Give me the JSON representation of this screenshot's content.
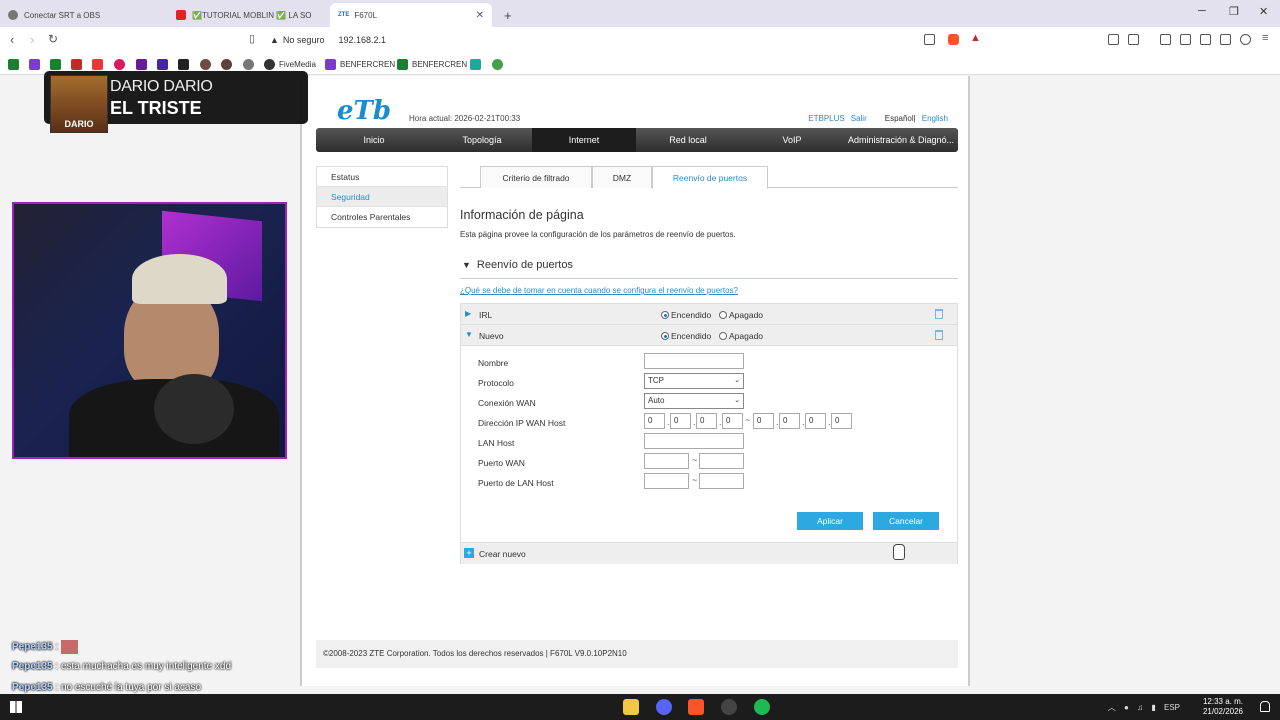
{
  "browser": {
    "tabs": [
      {
        "label": "Conectar SRT a OBS",
        "color": "#666"
      },
      {
        "label": "✅TUTORIAL MOBLIN ✅ LA SOLUCIÓ",
        "color": "#e02424"
      },
      {
        "label": "F670L",
        "prefix": "ZTE",
        "color": "#1a6bc4"
      }
    ],
    "new_tab": "+",
    "security_label": "No seguro",
    "url": "192.168.2.1",
    "bookmarks": [
      {
        "label": "",
        "color": "#1a7f2e"
      },
      {
        "label": "",
        "color": "#7d3cc8"
      },
      {
        "label": "",
        "color": "#1a7f2e"
      },
      {
        "label": "",
        "color": "#c62828"
      },
      {
        "label": "",
        "color": "#e53935"
      },
      {
        "label": "",
        "color": "#d81b60"
      },
      {
        "label": "",
        "color": "#6a1b9a"
      },
      {
        "label": "",
        "color": "#4527a0"
      },
      {
        "label": "",
        "color": "#212121"
      },
      {
        "label": "",
        "color": "#6d4c41"
      },
      {
        "label": "",
        "color": "#5d4037"
      },
      {
        "label": "FiveMedia",
        "color": "#333"
      },
      {
        "label": "BENFERCREN",
        "color": "#7d3cc8"
      },
      {
        "label": "BENFERCREN",
        "color": "#1a7f2e"
      },
      {
        "label": "",
        "color": "#26a69a"
      },
      {
        "label": "",
        "color": "#43a047"
      }
    ]
  },
  "router": {
    "logo": "eTb",
    "time_label": "Hora actual: 2026-02-21T00:33",
    "top_links": [
      "ETBPLUS",
      "Salir"
    ],
    "lang": {
      "current": "Español",
      "separator": "|",
      "other": "English"
    },
    "menu": [
      {
        "label": "Inicio",
        "active": false
      },
      {
        "label": "Topología",
        "active": false
      },
      {
        "label": "Internet",
        "active": true
      },
      {
        "label": "Red local",
        "active": false
      },
      {
        "label": "VoIP",
        "active": false
      },
      {
        "label": "Administración & Diagnó...",
        "active": false
      }
    ],
    "sidenav": [
      {
        "label": "Estatus",
        "active": false
      },
      {
        "label": "Seguridad",
        "active": true
      },
      {
        "label": "Controles Parentales",
        "active": false
      }
    ],
    "subtabs": [
      {
        "label": "Criterio de filtrado",
        "active": false
      },
      {
        "label": "DMZ",
        "active": false
      },
      {
        "label": "Reenvío de puertos",
        "active": true
      }
    ],
    "page_info_title": "Información de página",
    "page_info_desc": "Esta página provee la configuración de los parámetros de reenvío de puertos.",
    "section_title": "Reenvío de puertos",
    "help_link": "¿Qué se debe de tomar en cuenta cuando se configura el reenvío de puertos?",
    "rules": [
      {
        "name": "IRL",
        "on_label": "Encendido",
        "off_label": "Apagado",
        "enabled": true
      },
      {
        "name": "Nuevo",
        "on_label": "Encendido",
        "off_label": "Apagado",
        "enabled": true
      }
    ],
    "form": {
      "nombre_label": "Nombre",
      "nombre_value": "",
      "protocolo_label": "Protocolo",
      "protocolo_value": "TCP",
      "conexion_label": "Conexión WAN",
      "conexion_value": "Auto",
      "ip_wan_label": "Dirección IP WAN Host",
      "ip_start": [
        "0",
        "0",
        "0",
        "0"
      ],
      "ip_end": [
        "0",
        "0",
        "0",
        "0"
      ],
      "ip_dot": ".",
      "range_dash": "~",
      "lan_host_label": "LAN Host",
      "lan_host_value": "",
      "puerto_wan_label": "Puerto WAN",
      "puerto_lan_label": "Puerto de LAN Host"
    },
    "apply_label": "Aplicar",
    "cancel_label": "Cancelar",
    "create_label": "Crear nuevo",
    "footer": "©2008-2023 ZTE Corporation. Todos los derechos reservados  |   F670L V9.0.10P2N10"
  },
  "overlay": {
    "name1": "DARIO DARIO",
    "name2": "EL TRISTE",
    "photo_text": "DARIO",
    "chat": [
      {
        "user": "Pepe135",
        "text": ""
      },
      {
        "user": "Pepe135",
        "text": "esta muchacha es muy inteligente xdd"
      },
      {
        "user": "Pepe135",
        "text": "no escuché la tuya por si acaso"
      }
    ]
  },
  "taskbar": {
    "lang": "ESP",
    "time": "12:33 a. m.",
    "date": "21/02/2026",
    "icons": [
      {
        "name": "file-explorer",
        "color": "#f2c744"
      },
      {
        "name": "discord",
        "color": "#5865f2"
      },
      {
        "name": "brave",
        "color": "#fb542b"
      },
      {
        "name": "obs",
        "color": "#444"
      },
      {
        "name": "spotify",
        "color": "#1db954"
      }
    ]
  }
}
